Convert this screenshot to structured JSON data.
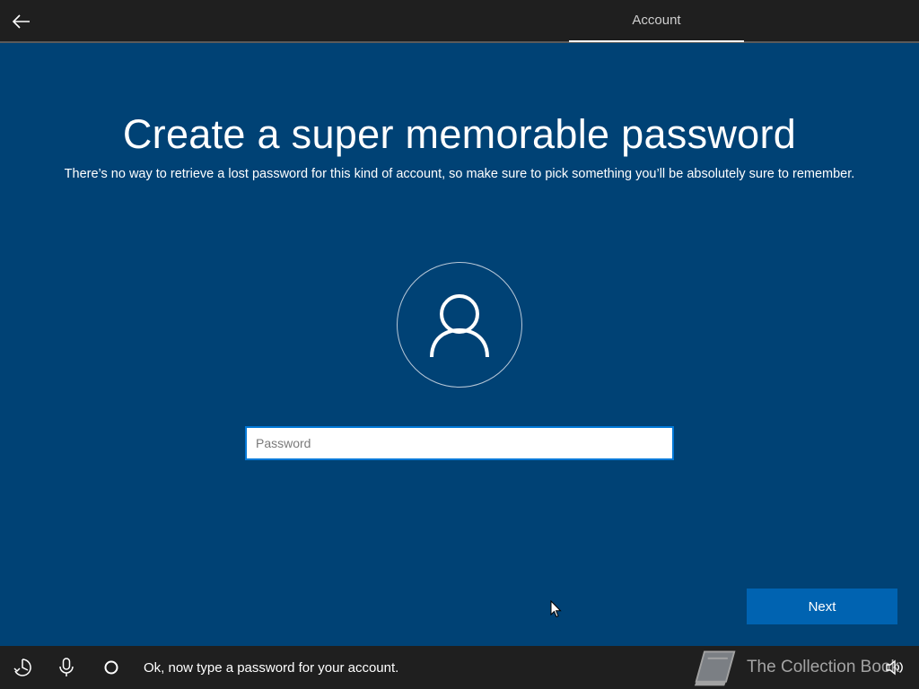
{
  "header": {
    "tab_label": "Account"
  },
  "main": {
    "title": "Create a super memorable password",
    "subtitle": "There’s no way to retrieve a lost password for this kind of account, so make sure to pick something you’ll be absolutely sure to remember.",
    "password_placeholder": "Password",
    "password_value": "",
    "next_label": "Next"
  },
  "taskbar": {
    "cortana_message": "Ok, now type a password for your account.",
    "icons": [
      "ease-of-access-icon",
      "microphone-icon",
      "cortana-circle-icon",
      "volume-icon"
    ]
  },
  "watermark": {
    "text": "The Collection Book"
  },
  "colors": {
    "background": "#004275",
    "topbar": "#1f1f1f",
    "accent": "#0063b1",
    "input_border": "#0078d7"
  }
}
